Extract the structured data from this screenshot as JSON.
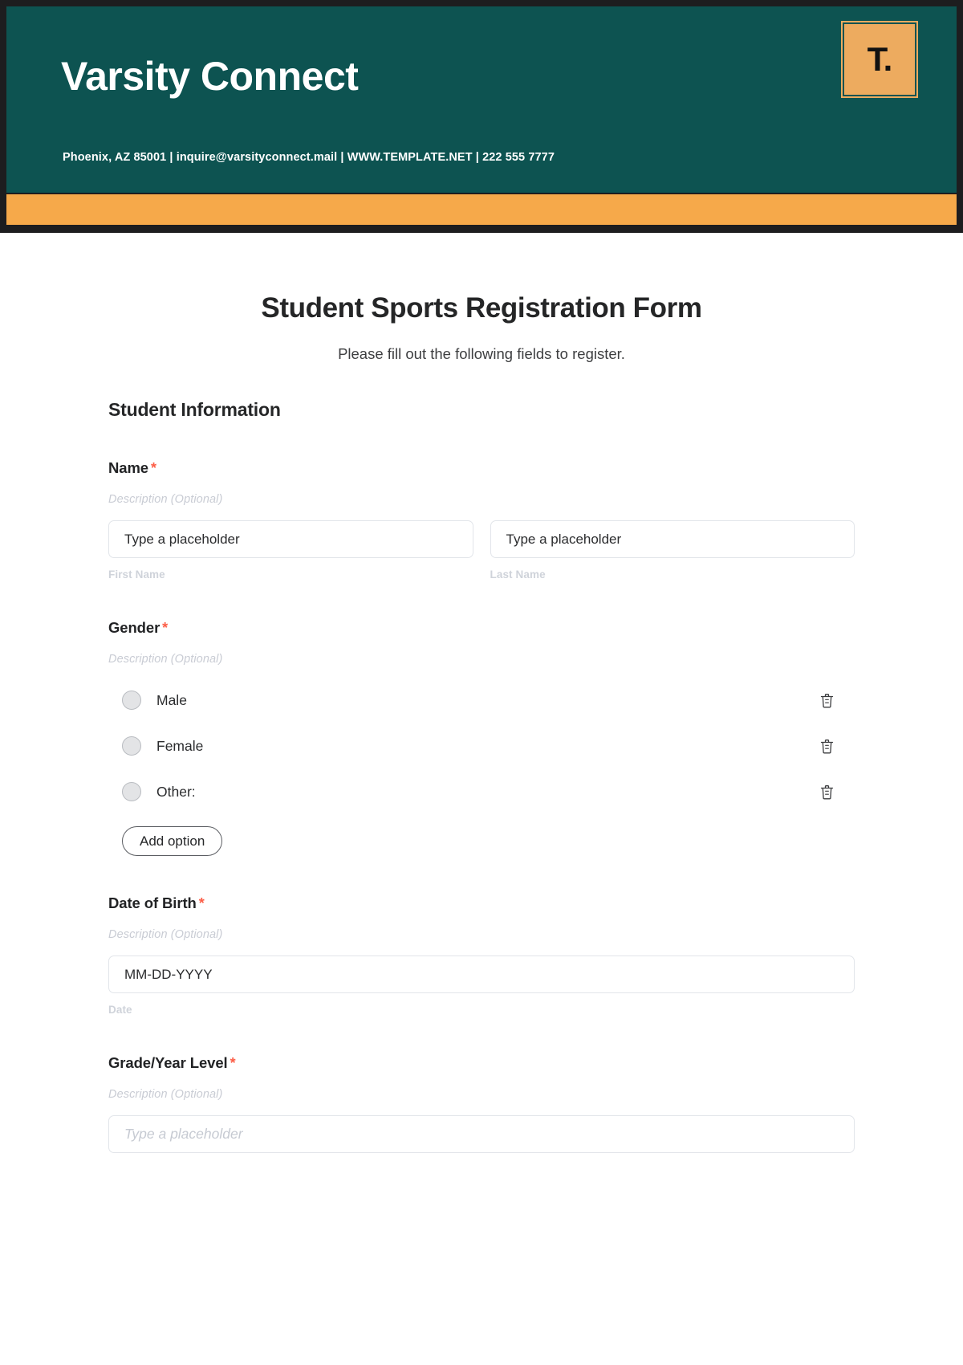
{
  "letterhead": {
    "brand_name": "Varsity Connect",
    "contact_line": "Phoenix, AZ 85001 | inquire@varsityconnect.mail | WWW.TEMPLATE.NET | 222 555 7777",
    "logo_glyph": "T.",
    "colors": {
      "frame": "#1d1d1f",
      "panel": "#0d5351",
      "accent_bar": "#f6a94a",
      "logo_badge": "#edab5f"
    }
  },
  "form": {
    "title": "Student Sports Registration Form",
    "subtitle": "Please fill out the following fields to register.",
    "section_heading": "Student Information",
    "required_marker": "*",
    "required_color": "#fc5e47",
    "fields": {
      "name": {
        "label": "Name",
        "description": "Description (Optional)",
        "first": {
          "value": "Type a placeholder",
          "sub_label": "First Name"
        },
        "last": {
          "value": "Type a placeholder",
          "sub_label": "Last Name"
        }
      },
      "gender": {
        "label": "Gender",
        "description": "Description (Optional)",
        "options": [
          {
            "label": "Male"
          },
          {
            "label": "Female"
          },
          {
            "label": "Other:"
          }
        ],
        "add_option_label": "Add option",
        "delete_icon": "trash-icon"
      },
      "date_of_birth": {
        "label": "Date of Birth",
        "description": "Description (Optional)",
        "value": "MM-DD-YYYY",
        "sub_label": "Date"
      },
      "grade_year_level": {
        "label": "Grade/Year Level",
        "description": "Description (Optional)",
        "placeholder": "Type a placeholder"
      }
    }
  }
}
